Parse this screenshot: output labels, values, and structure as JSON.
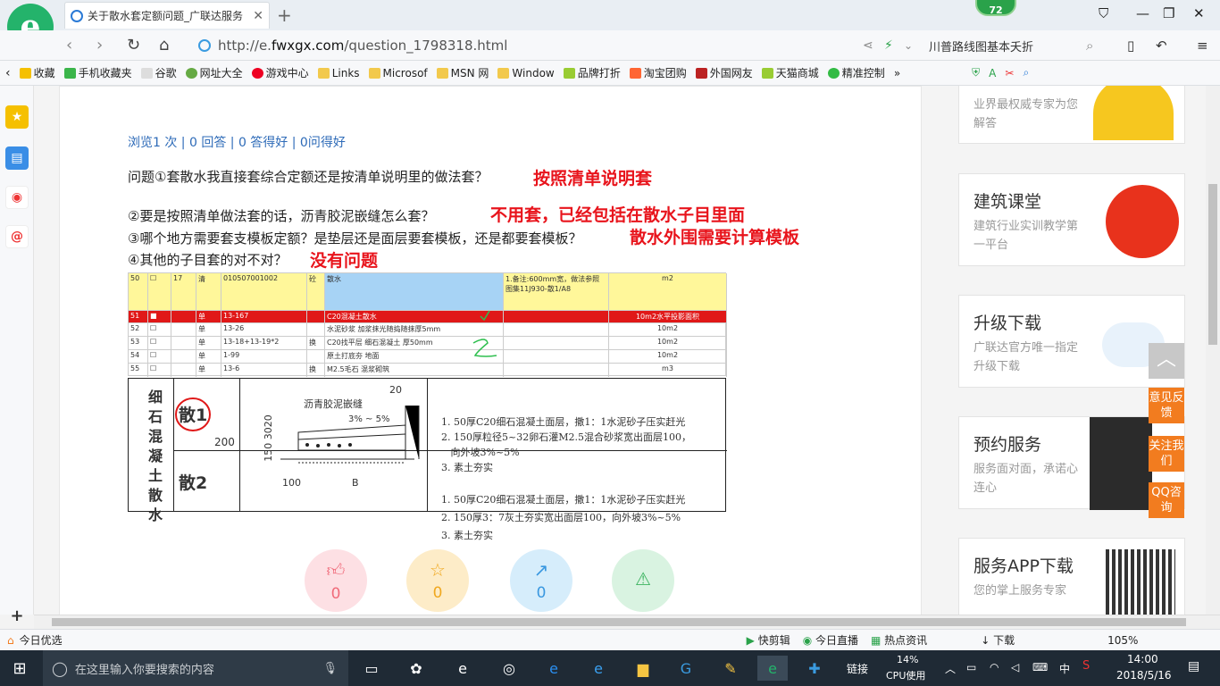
{
  "browser": {
    "tab_title": "关于散水套定额问题_广联达服务",
    "url_host": "http://e.",
    "url_domain": "fwxgx.com",
    "url_path": "/question_1798318.html",
    "search_text": "川普路线图基本夭折",
    "badge": "72"
  },
  "bookmarks": [
    "收藏",
    "手机收藏夹",
    "谷歌",
    "网址大全",
    "游戏中心",
    "Links",
    "Microsof",
    "MSN 网",
    "Window",
    "品牌打折",
    "淘宝团购",
    "外国网友",
    "天猫商城",
    "精准控制"
  ],
  "question": {
    "stats": "浏览1 次 | 0 回答 | 0 答得好 | 0问得好",
    "q1": "问题①套散水我直接套综合定额还是按清单说明里的做法套？",
    "a1": "按照清单说明套",
    "q2": "②要是按照清单做法套的话，沥青胶泥嵌缝怎么套？",
    "a2": "不用套，已经包括在散水子目里面",
    "q3": "③哪个地方需要套支模板定额？是垫层还是面层要套模板，还是都要套模板？",
    "a3": "散水外围需要计算模板",
    "q4": "④其他的子目套的对不对？",
    "a4": "没有问题"
  },
  "sheet": {
    "rows": [
      [
        "50",
        "☐",
        "17",
        "清",
        "010507001002",
        "砼",
        "散水",
        "1.备注:600mm宽，做法参照图集11J930-散1/A8",
        "m2"
      ],
      [
        "51",
        "■",
        "",
        "单",
        "13-167",
        "",
        "C20混凝土散水",
        "",
        "10m2水平投影面积"
      ],
      [
        "52",
        "☐",
        "",
        "单",
        "13-26",
        "",
        "水泥砂浆 加浆抹光随捣随抹厚5mm",
        "",
        "10m2"
      ],
      [
        "53",
        "☐",
        "",
        "单",
        "13-18+13-19*2",
        "换",
        "C20找平层 细石混凝土 厚50mm",
        "",
        "10m2"
      ],
      [
        "54",
        "☐",
        "",
        "单",
        "1-99",
        "",
        "原土打底夯 地面",
        "",
        "10m2"
      ],
      [
        "55",
        "☐",
        "",
        "单",
        "13-6",
        "换",
        "M2.5毛石 混浆砌筑",
        "",
        "m3"
      ]
    ]
  },
  "drawing": {
    "category": "细石混凝土散水",
    "label1": "散1",
    "label2": "散2",
    "width": "200",
    "dim_left": "150 3020",
    "dim_b": "B",
    "dim_100": "100",
    "dim_20": "20",
    "seal": "沥青胶泥嵌缝",
    "slope": "3% ~ 5%",
    "spec1": [
      "1. 50厚C20细石混凝土面层，撒1：1水泥砂子压实赶光",
      "2. 150厚粒径5~32卵石灌M2.5混合砂浆宽出面层100，",
      "   向外坡3%~5%",
      "3. 素土夯实"
    ],
    "spec2": [
      "1. 50厚C20细石混凝土面层，撒1：1水泥砂子压实赶光",
      "2. 150厚3：7灰土夯实宽出面层100，向外坡3%~5%",
      "3. 素土夯实"
    ]
  },
  "reactions": [
    "0",
    "0",
    "0",
    ""
  ],
  "right_cards": [
    {
      "title": "",
      "sub": "业界最权威专家为您解答"
    },
    {
      "title": "建筑课堂",
      "sub": "建筑行业实训教学第一平台"
    },
    {
      "title": "升级下载",
      "sub": "广联达官方唯一指定升级下载"
    },
    {
      "title": "预约服务",
      "sub": "服务面对面，承诺心连心"
    },
    {
      "title": "服务APP下载",
      "sub": "您的掌上服务专家"
    }
  ],
  "float_buttons": [
    "意见反馈",
    "关注我们",
    "QQ咨询"
  ],
  "status": {
    "left": "今日优选",
    "items": [
      "快剪辑",
      "今日直播",
      "热点资讯",
      "下载"
    ],
    "zoom": "105%"
  },
  "taskbar": {
    "search_placeholder": "在这里输入你要搜索的内容",
    "link": "链接",
    "cpu": "14%",
    "cpu_label": "CPU使用",
    "time": "14:00",
    "date": "2018/5/16",
    "ime": "中"
  }
}
